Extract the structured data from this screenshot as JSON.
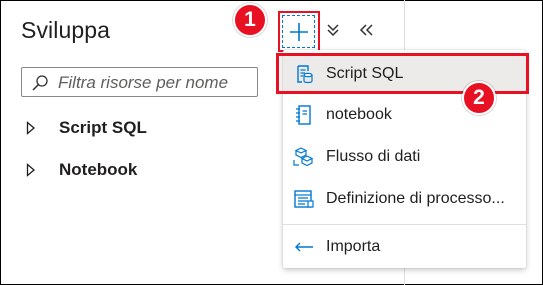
{
  "panel": {
    "title": "Sviluppa",
    "search_placeholder": "Filtra risorse per nome",
    "tree": [
      {
        "label": "Script SQL",
        "icon": "chevron-right-icon"
      },
      {
        "label": "Notebook",
        "icon": "chevron-right-icon"
      }
    ]
  },
  "toolbar": {
    "add_icon": "plus-icon",
    "expand_icon": "double-chevron-down-icon",
    "collapse_icon": "double-chevron-left-icon"
  },
  "menu": {
    "items": [
      {
        "label": "Script SQL",
        "icon": "sql-script-icon",
        "selected": true
      },
      {
        "label": "notebook",
        "icon": "notebook-icon",
        "selected": false
      },
      {
        "label": "Flusso di dati",
        "icon": "data-flow-icon",
        "selected": false
      },
      {
        "label": "Definizione di processo...",
        "icon": "job-definition-icon",
        "selected": false
      },
      {
        "label": "Importa",
        "icon": "import-icon",
        "selected": false
      }
    ]
  },
  "callouts": [
    "1",
    "2"
  ],
  "colors": {
    "accent": "#0078d4",
    "callout": "#e81123"
  }
}
